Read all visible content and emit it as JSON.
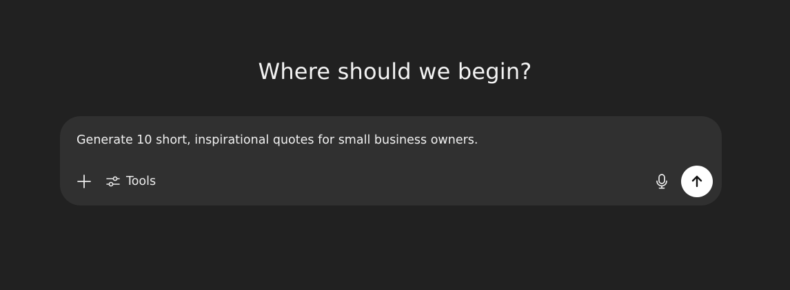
{
  "main": {
    "heading": "Where should we begin?"
  },
  "composer": {
    "prompt_text": "Generate 10 short, inspirational quotes for small business owners.",
    "tools_label": "Tools",
    "icons": {
      "add": "plus-icon",
      "tools": "sliders-icon",
      "voice": "microphone-icon",
      "send": "arrow-up-icon"
    }
  },
  "colors": {
    "background": "#212121",
    "composer_background": "#303030",
    "text": "#ececec",
    "send_button": "#ffffff"
  }
}
